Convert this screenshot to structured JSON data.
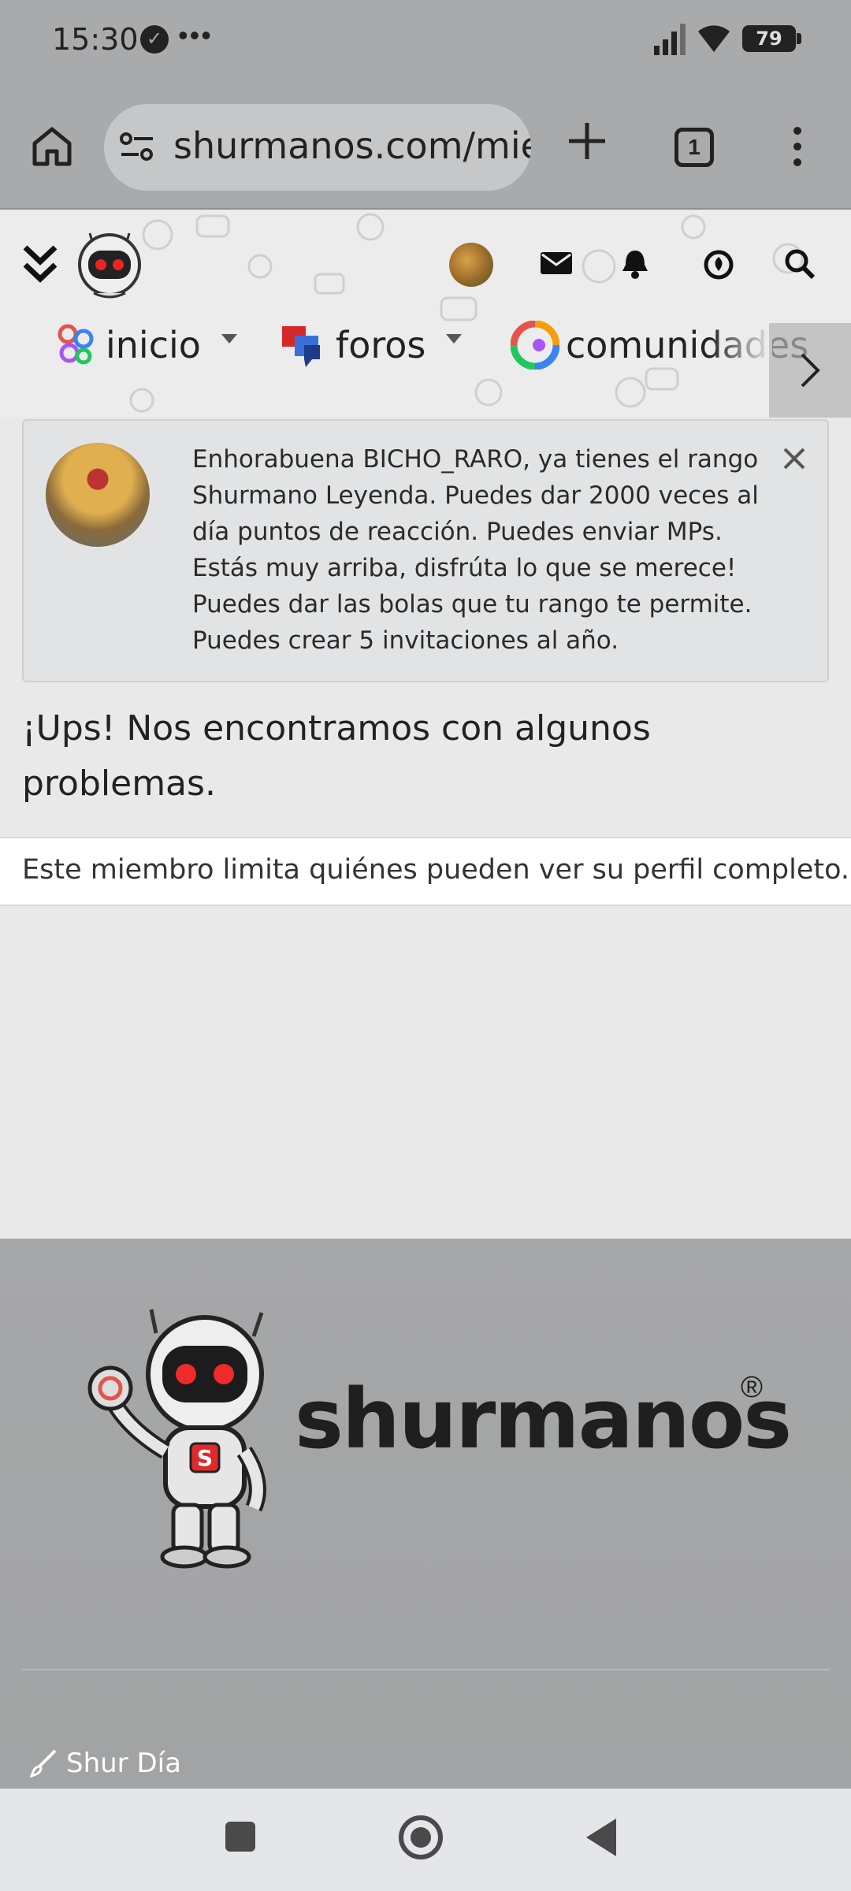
{
  "status_bar": {
    "time": "15:30",
    "battery": "79"
  },
  "browser": {
    "url": "shurmanos.com/miem",
    "tab_count": "1"
  },
  "site_header": {
    "nav_items": [
      {
        "label": "inicio"
      },
      {
        "label": "foros"
      },
      {
        "label": "comunidades"
      }
    ]
  },
  "notice": {
    "text": "Enhorabuena BICHO_RARO, ya tienes el rango Shurmano Leyenda. Puedes dar 2000 veces al día puntos de reacción. Puedes enviar MPs. Estás muy arriba, disfrúta lo que se merece! Puedes dar las bolas que tu rango te permite. Puedes crear 5 invitaciones al año."
  },
  "error": {
    "title": "¡Ups! Nos encontramos con algunos problemas.",
    "message": "Este miembro limita quiénes pueden ver su perfil completo."
  },
  "footer": {
    "brand": "shurmanos",
    "reg_mark": "®",
    "link_label": "Shur Día"
  },
  "colors": {
    "chrome_bg": "#a9aaab",
    "page_bg": "#e9e9e9",
    "footer_bg": "#a6a7a8",
    "notice_bg": "#e2e3e4"
  }
}
